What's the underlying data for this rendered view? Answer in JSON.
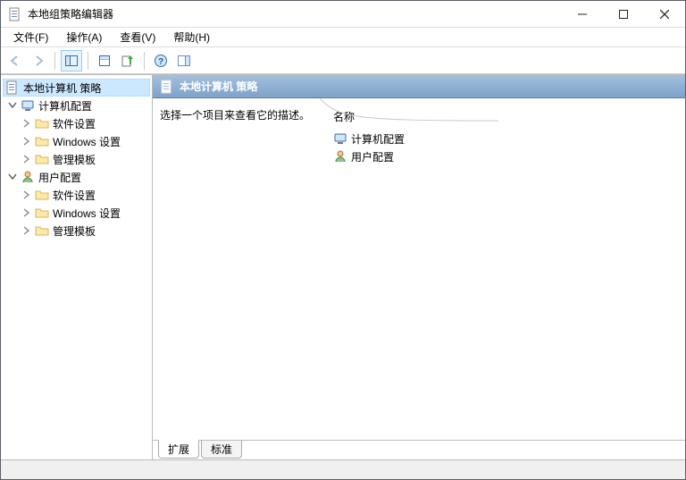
{
  "window": {
    "title": "本地组策略编辑器"
  },
  "menu": {
    "file": "文件(F)",
    "action": "操作(A)",
    "view": "查看(V)",
    "help": "帮助(H)"
  },
  "tree": {
    "root": "本地计算机 策略",
    "computer_config": "计算机配置",
    "software_settings": "软件设置",
    "windows_settings": "Windows 设置",
    "admin_templates": "管理模板",
    "user_config": "用户配置"
  },
  "detail": {
    "header_title": "本地计算机 策略",
    "prompt": "选择一个项目来查看它的描述。",
    "column_name": "名称",
    "items": [
      {
        "label": "计算机配置"
      },
      {
        "label": "用户配置"
      }
    ]
  },
  "tabs": {
    "extended": "扩展",
    "standard": "标准"
  }
}
